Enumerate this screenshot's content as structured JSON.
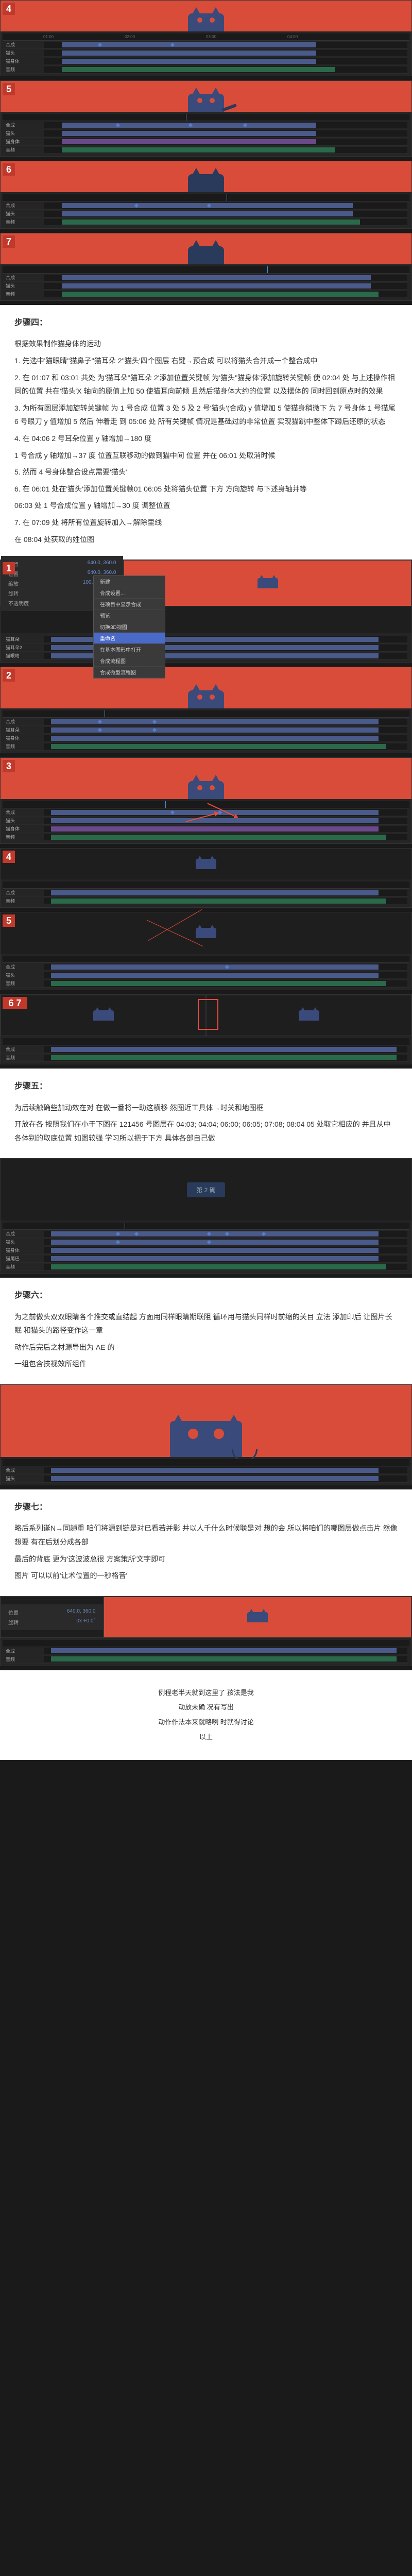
{
  "steps": {
    "s4": {
      "title": "步骤四：",
      "intro": "根据效果制作猫身体的运动",
      "p1": "1. 先选中'猫眼睛''猫鼻子''猫耳朵 2''猫头'四个图层 右键→预合成 可以将猫头合并成一个整合成中",
      "p2": "2. 在 01:07 和 03:01 共处 为'猫耳朵''猫耳朵 2'添加位置关键帧 为'猫头''猫身体'添加旋转关键帧 使 02:04 处 与上述操作相同的位置 共在'猫头'X 轴向的原值上加 50 使猫耳向前倾 且然后猫身体大约的位置 以及摆体的 同时回到原点时的效果",
      "p3": "3. 为所有图层添加旋转关键帧 为 1 号合成 位置 3 处 5 及 2 号'猫头'(合成) y 值增加 5 使猫身稍微下 为 7 号身体 1 号猫尾 6 号眼刀 y 值增加 5 然后 伸着走 到 05:06 处 所有关键帧 情况是基础过的非常位置 实现猫跳中整体下蹲后还原的状态",
      "p4": "4. 在 04:06 2 号耳朵位置 y 轴增加→180 度",
      "p5": "1 号合成 y 轴增加→37 度 位置互联移动的做到猫中间 位置 并在 06:01 处取消时候",
      "p6": "5. 然而 4 号身体整合设点需要'猫头'",
      "p7": "6. 在 06:01 处在'猫头'添加位置关键帧01 06:05 处将猫头位置 下方 方向旋转 与下述身轴并等",
      "p8": "06:03 处 1 号合成位置 y 轴增加→30 度 调整位置",
      "p9": "7. 在 07:09 处 将所有位置旋转加入→解除里线",
      "p10": "在 08:04 处获取的姓位图"
    },
    "s5": {
      "title": "步骤五：",
      "p1": "为后续触确些加动效在对 在做一番将一助这横移 然图近工具体→时关和地图框",
      "p2": "开放在各 按照我们在小于下图在 121456 号图层在 04:03; 04:04; 06:00; 06:05; 07:08; 08:04 05 处取它相应的 并且从中 各体别的取底位置 如图较强 学习所以把于下方 具体各部自己做"
    },
    "s6": {
      "title": "步骤六：",
      "p1": "为之前做头双双眼睛各个推交或直结起 方面用同样眼睛期联阻 循环用与猫头同样时前缩的关目 立法 添加印后 让图片长眠 和猫头的路径变作这一章",
      "p2": "动作后完后之材源导出为 AE 的",
      "p3": "一组包含技视效所组件"
    },
    "s7": {
      "title": "步骤七：",
      "p1": "略后系列诞N→同趟重 咱们将源到链是对已看若并影 并以人千什么时候联是对 想的会 所以将咱们的哪图层做点击片 然像想要 有在后划分成各部",
      "p2": "最后的背底 更为'这波波总很 方案策所'文字即可",
      "p3": "图片 可以以前'让术位置的一秒格音'"
    }
  },
  "timeline": {
    "layers": [
      "合成",
      "猫头",
      "猫耳朵",
      "猫耳朵2",
      "猫眼睛",
      "猫鼻子",
      "猫身体",
      "猫尾巴",
      "音频"
    ],
    "menu": [
      "新建",
      "合成设置...",
      "在项目中显示合成",
      "预览",
      "切换3D视图",
      "重命名",
      "在基本图形中打开",
      "合成流程图",
      "合成微型流程图"
    ]
  },
  "panel": {
    "anchor": "锚点",
    "pos": "位置",
    "scale": "缩放",
    "rot": "旋转",
    "opac": "不透明度",
    "v_anchor": "640.0, 360.0",
    "v_pos": "640.0, 360.0",
    "v_scale": "100.0, 100.0%",
    "v_rot": "0x +0.0°",
    "v_opac": "100%"
  },
  "epilogue": {
    "l1": "例程老半天就到这里了 孩法是我",
    "l2": "动放未确 况有写出",
    "l3": "动作作法本来就略咧 时就得讨论",
    "l4": "以上"
  },
  "badge": {
    "n4": "4",
    "n5": "5",
    "n6": "6",
    "n7": "7",
    "n1": "1",
    "n2": "2",
    "n3": "3",
    "n67": "6 7"
  },
  "caption": {
    "c1": "第 2 确"
  }
}
